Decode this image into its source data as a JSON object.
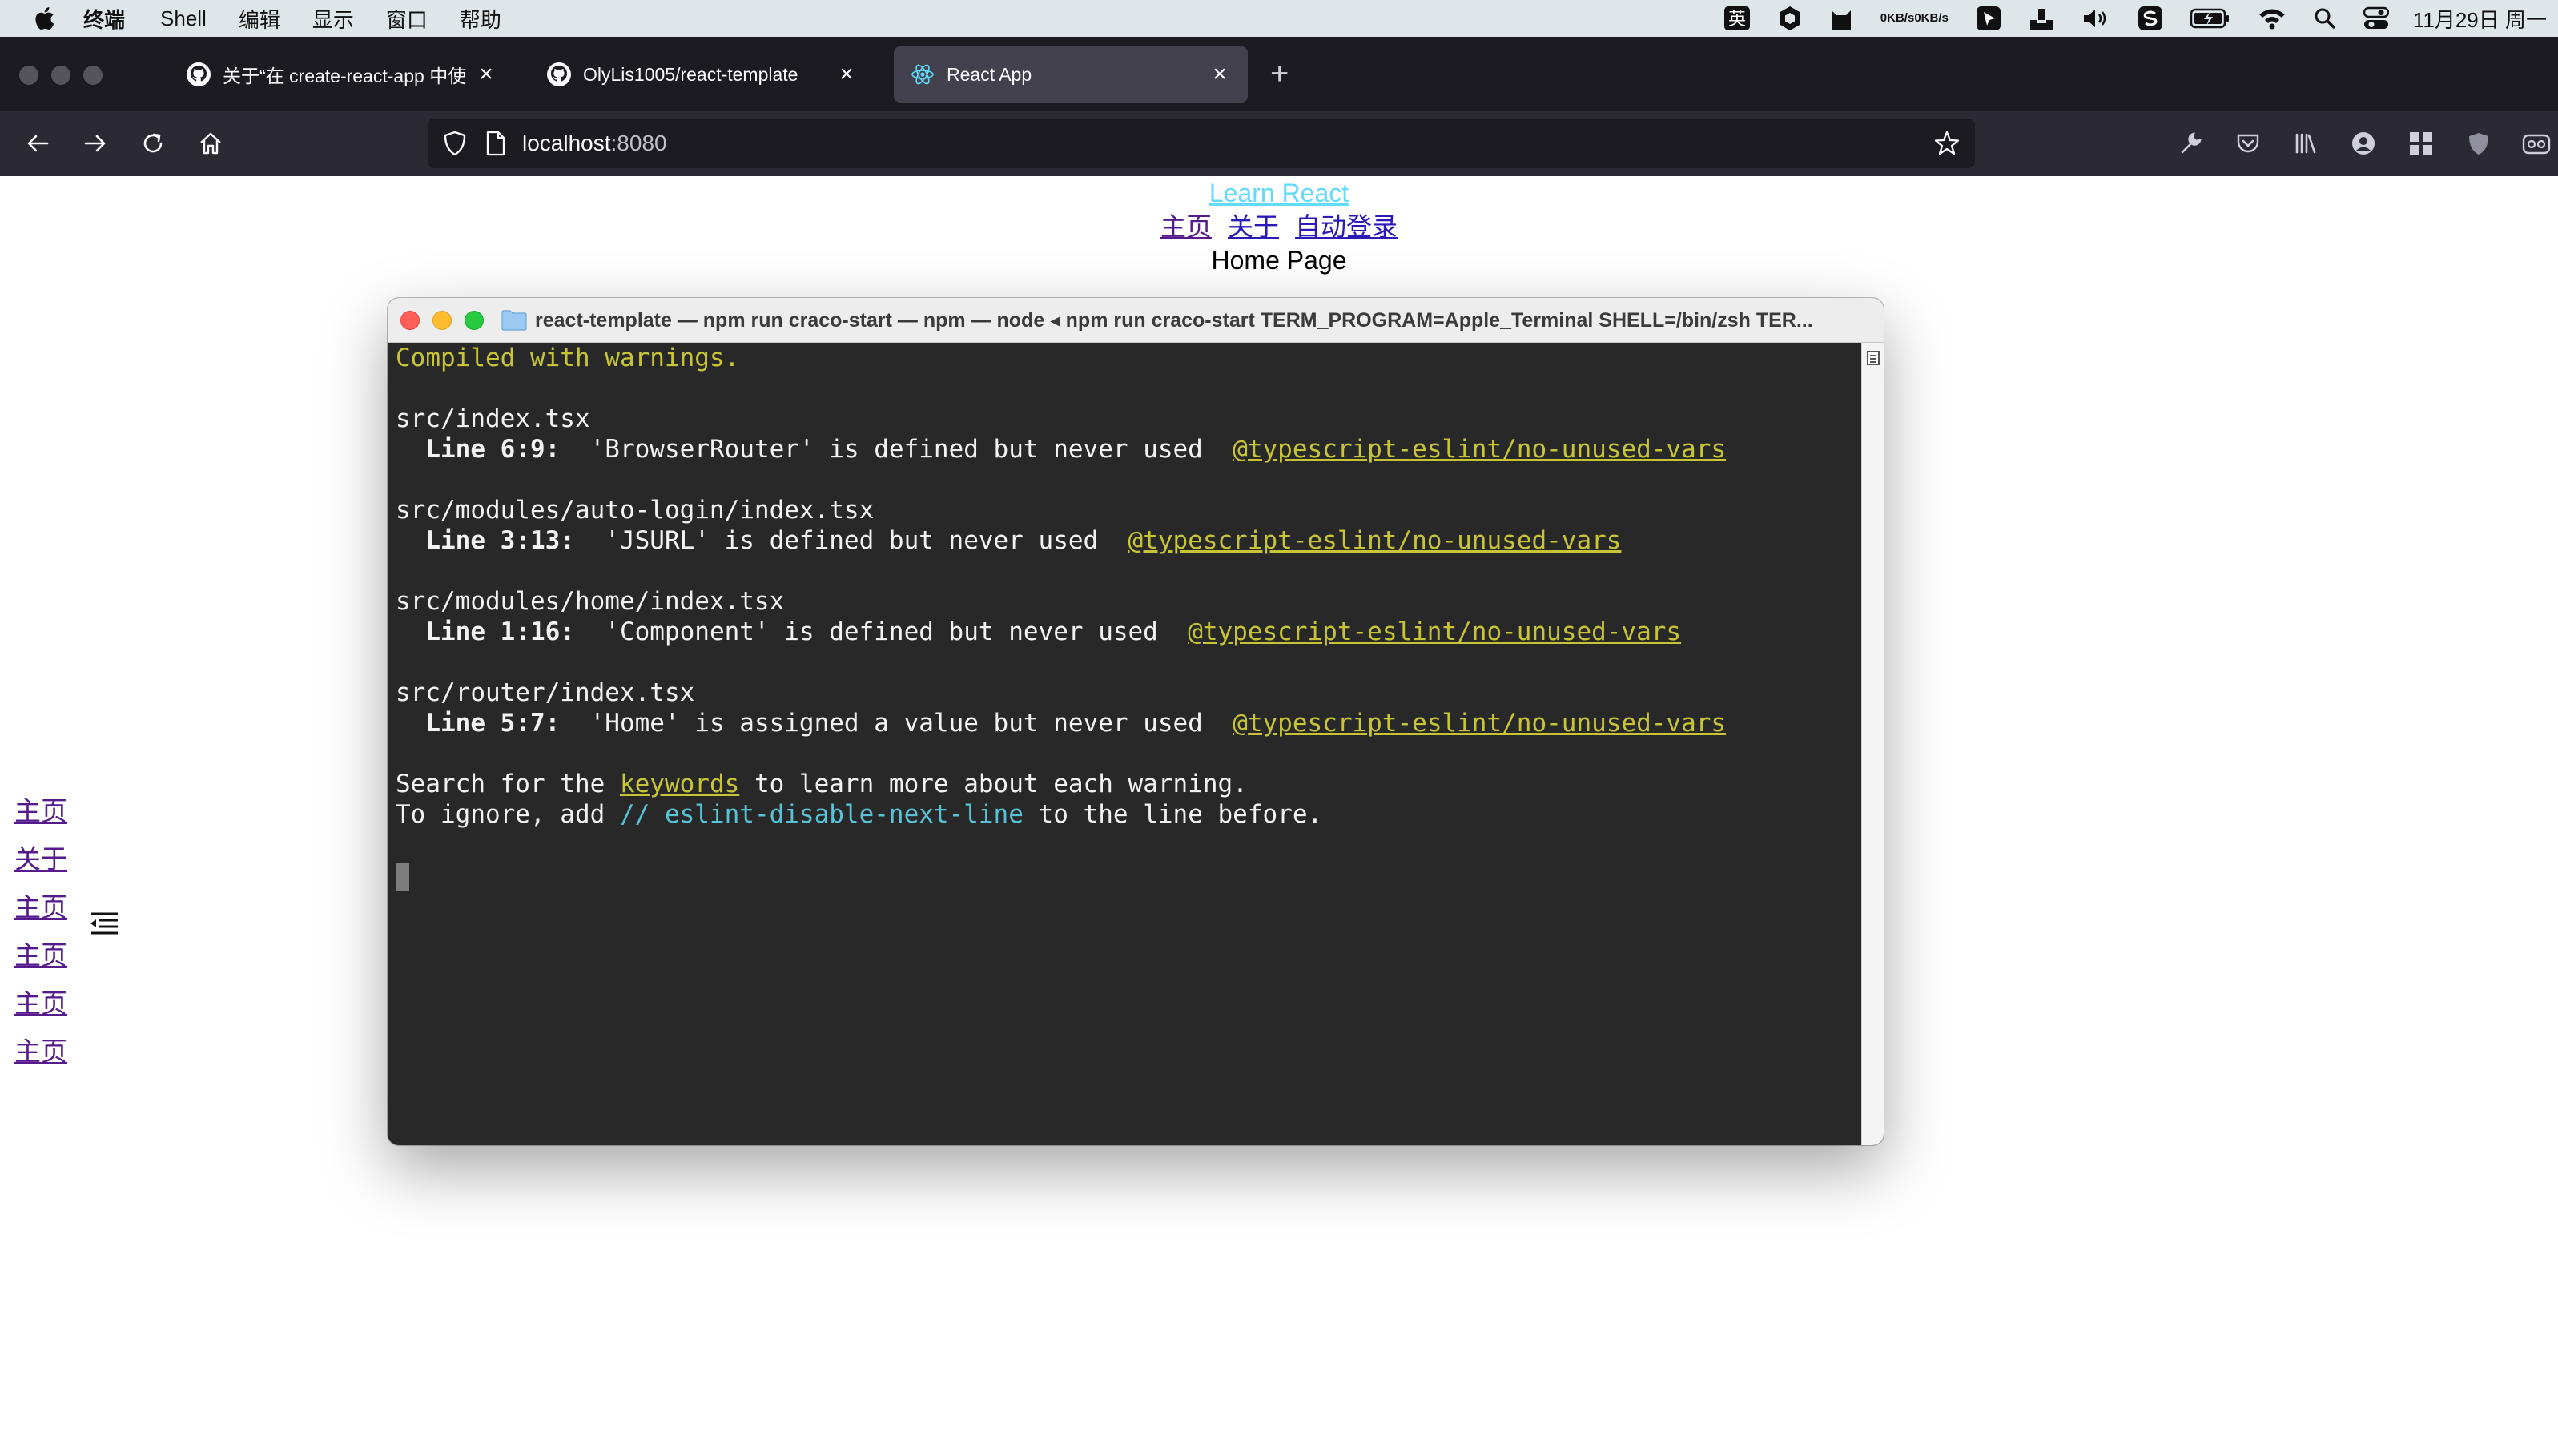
{
  "menubar": {
    "app_name": "终端",
    "items": [
      "Shell",
      "编辑",
      "显示",
      "窗口",
      "帮助"
    ],
    "network_up": "0KB/s",
    "network_down": "0KB/s",
    "input_method": "英",
    "clock": "11月29日 周一"
  },
  "browser": {
    "tabs": [
      {
        "title": "关于“在 create-react-app 中使用",
        "icon": "github-icon",
        "active": false
      },
      {
        "title": "OlyLis1005/react-template",
        "icon": "github-icon",
        "active": false
      },
      {
        "title": "React App",
        "icon": "react-icon",
        "active": true
      }
    ],
    "new_tab_label": "+",
    "url_host": "localhost",
    "url_port": ":8080"
  },
  "page": {
    "learn_link": "Learn React",
    "nav_links": [
      "主页",
      "关于",
      "自动登录"
    ],
    "home_title": "Home Page",
    "side_links": [
      "主页",
      "关于",
      "主页",
      "主页",
      "主页",
      "主页"
    ]
  },
  "terminal": {
    "title": "react-template — npm run craco-start — npm — node ◂ npm run craco-start TERM_PROGRAM=Apple_Terminal SHELL=/bin/zsh TER...",
    "compiled": "Compiled with warnings.",
    "warnings": [
      {
        "file": "src/index.tsx",
        "line": "  Line 6:9:",
        "message": "  'BrowserRouter' is defined but never used  ",
        "rule": "@typescript-eslint/no-unused-vars"
      },
      {
        "file": "src/modules/auto-login/index.tsx",
        "line": "  Line 3:13:",
        "message": "  'JSURL' is defined but never used  ",
        "rule": "@typescript-eslint/no-unused-vars"
      },
      {
        "file": "src/modules/home/index.tsx",
        "line": "  Line 1:16:",
        "message": "  'Component' is defined but never used  ",
        "rule": "@typescript-eslint/no-unused-vars"
      },
      {
        "file": "src/router/index.tsx",
        "line": "  Line 5:7:",
        "message": "  'Home' is assigned a value but never used  ",
        "rule": "@typescript-eslint/no-unused-vars"
      }
    ],
    "search_prefix": "Search for the ",
    "search_keyword": "keywords",
    "search_suffix": " to learn more about each warning.",
    "ignore_prefix": "To ignore, add ",
    "ignore_comment": "// eslint-disable-next-line",
    "ignore_suffix": " to the line before."
  },
  "colors": {
    "menubar_bg": "#dfe6ea",
    "browser_bg": "#1c1b22",
    "toolbar_bg": "#2b2a33",
    "terminal_bg": "#282828",
    "warning_yellow": "#c7c435",
    "comment_cyan": "#58c3d6",
    "react_link": "#61dafb"
  }
}
